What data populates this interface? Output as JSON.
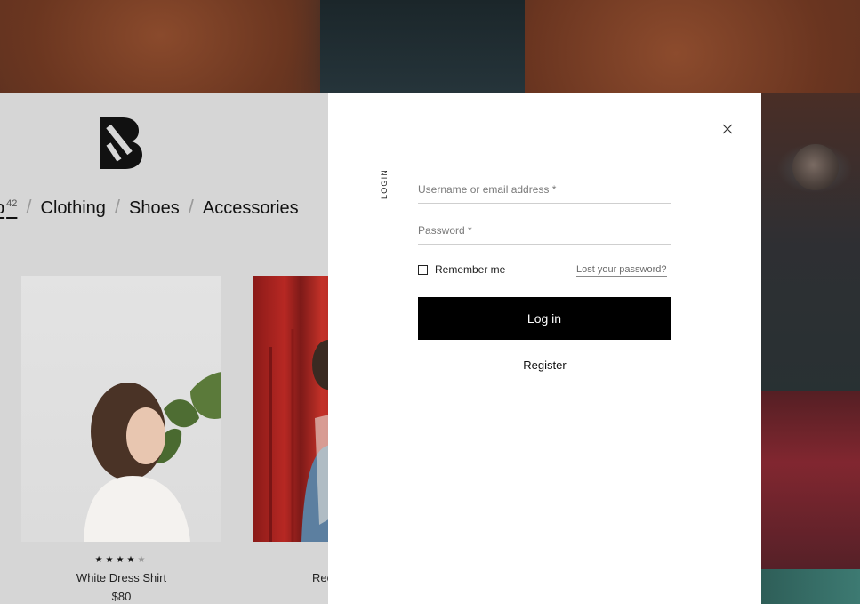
{
  "brand": {
    "logo_icon": "brand-logo-icon"
  },
  "nav": {
    "items": [
      {
        "label": "Shop",
        "visible_fragment": "p",
        "count": "42"
      },
      {
        "label": "Clothing"
      },
      {
        "label": "Shoes"
      },
      {
        "label": "Accessories"
      }
    ],
    "separator": "/"
  },
  "products": [
    {
      "name": "White Dress Shirt",
      "price": "$80",
      "rating": 4,
      "rating_max": 5
    },
    {
      "name_fragment": "Rec"
    }
  ],
  "login": {
    "section_label": "LOGIN",
    "username_placeholder": "Username or email address *",
    "password_placeholder": "Password *",
    "remember_label": "Remember me",
    "lost_password_label": "Lost your password?",
    "submit_label": "Log in",
    "register_label": "Register",
    "close_icon": "close-icon"
  },
  "colors": {
    "modal_bg": "#ffffff",
    "button_bg": "#000000",
    "overlay_page_bg": "#d6d6d6"
  }
}
